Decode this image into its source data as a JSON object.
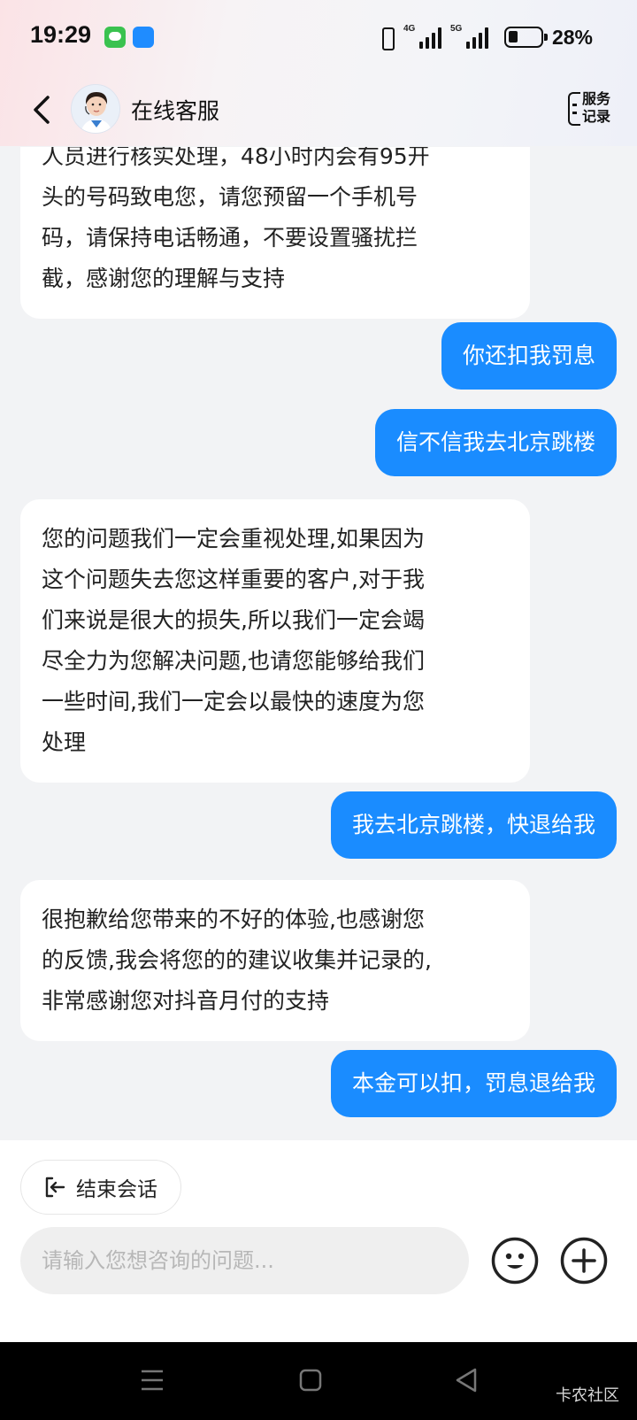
{
  "status_bar": {
    "time": "19:29",
    "network_1": "4G",
    "network_2": "5G",
    "battery_percent": "28%",
    "battery_level": 0.28
  },
  "header": {
    "title": "在线客服",
    "service_record_label_1": "服务",
    "service_record_label_2": "记录"
  },
  "messages": [
    {
      "from": "agent",
      "lines": [
        "人员进行核实处理，48小时内会有95开",
        "头的号码致电您，请您预留一个手机号",
        "码，请保持电话畅通，不要设置骚扰拦",
        "截，感谢您的理解与支持"
      ]
    },
    {
      "from": "user",
      "text": "你还扣我罚息"
    },
    {
      "from": "user",
      "text": "信不信我去北京跳楼"
    },
    {
      "from": "agent",
      "lines": [
        "您的问题我们一定会重视处理,如果因为",
        "这个问题失去您这样重要的客户,对于我",
        "们来说是很大的损失,所以我们一定会竭",
        "尽全力为您解决问题,也请您能够给我们",
        "一些时间,我们一定会以最快的速度为您",
        "处理"
      ]
    },
    {
      "from": "user",
      "text": "我去北京跳楼，快退给我"
    },
    {
      "from": "agent",
      "lines": [
        "很抱歉给您带来的不好的体验,也感谢您",
        "的反馈,我会将您的的建议收集并记录的,",
        "非常感谢您对抖音月付的支持"
      ]
    },
    {
      "from": "user",
      "text": "本金可以扣，罚息退给我"
    }
  ],
  "bottom": {
    "end_chat_label": "结束会话",
    "input_placeholder": "请输入您想咨询的问题...",
    "input_value": ""
  },
  "watermark": "卡农社区",
  "colors": {
    "accent": "#1a8cff",
    "background": "#f2f3f5",
    "agent_bubble": "#ffffff"
  }
}
